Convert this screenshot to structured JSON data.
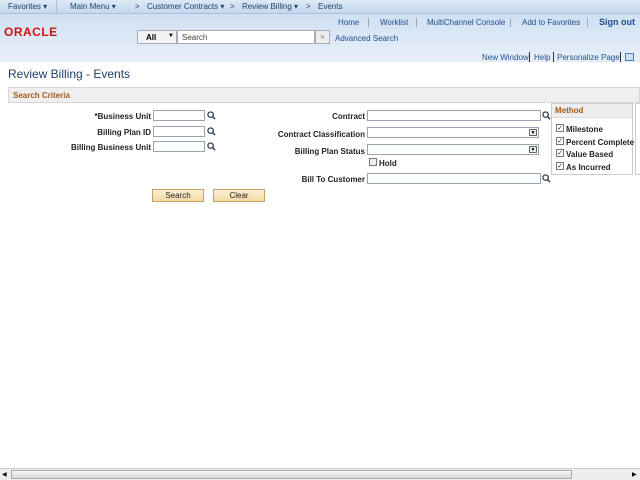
{
  "nav": {
    "favorites": "Favorites ▾",
    "main_menu": "Main Menu ▾",
    "customer_contracts": "Customer Contracts ▾",
    "review_billing": "Review Billing ▾",
    "events": "Events",
    "sep": ">"
  },
  "header": {
    "links": [
      "Home",
      "Worklist",
      "MultiChannel Console",
      "Add to Favorites",
      "Sign out"
    ],
    "logo": "ORACLE",
    "search_scope": "All",
    "search_placeholder": "Search",
    "advanced_search": "Advanced Search"
  },
  "page_links": {
    "new_window": "New Window",
    "help": "Help",
    "personalize": "Personalize Page"
  },
  "title": "Review Billing - Events",
  "section": "Search Criteria",
  "fields": {
    "business_unit": "*Business Unit",
    "billing_plan_id": "Billing Plan ID",
    "billing_business_unit": "Billing Business Unit",
    "contract": "Contract",
    "contract_classification": "Contract Classification",
    "billing_plan_status": "Billing Plan Status",
    "hold": "Hold",
    "bill_to_customer": "Bill To Customer"
  },
  "method": {
    "title": "Method",
    "items": [
      {
        "label": "Milestone",
        "checked": true
      },
      {
        "label": "Percent Complete",
        "checked": true
      },
      {
        "label": "Value Based",
        "checked": true
      },
      {
        "label": "As Incurred",
        "checked": true
      }
    ]
  },
  "buttons": {
    "search": "Search",
    "clear": "Clear"
  },
  "colors": {
    "accent": "#a25a18",
    "link": "#1f4e8c",
    "oracle_red": "#d2130e"
  }
}
